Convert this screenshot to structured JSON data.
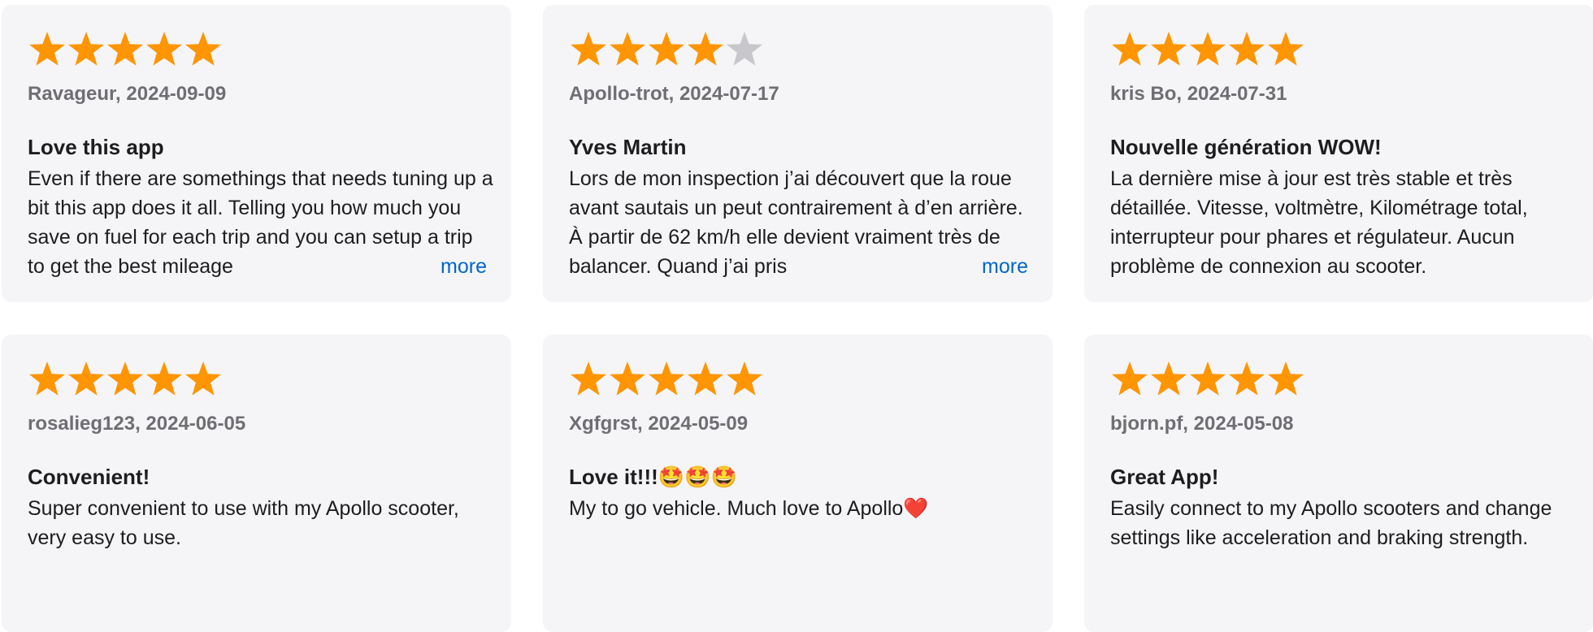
{
  "colors": {
    "star_filled": "#ff9500",
    "star_empty": "#c7c7cc",
    "link": "#0066cc"
  },
  "reviews": [
    {
      "rating": 5,
      "author_date": "Ravageur, 2024-09-09",
      "title": "Love this app",
      "body": "Even if there are somethings that needs tuning up a bit this app does it all. Telling you how much you save on fuel for each trip and you can setup a trip to get the best mileage",
      "more_label": "more"
    },
    {
      "rating": 4,
      "author_date": "Apollo-trot, 2024-07-17",
      "title": "Yves Martin",
      "body": "Lors de mon inspection j’ai découvert que la roue avant sautais un peut contrairement à d’en arrière. À partir de 62 km/h elle devient vraiment très de balancer. Quand j’ai pris",
      "more_label": "more"
    },
    {
      "rating": 5,
      "author_date": "kris Bo, 2024-07-31",
      "title": "Nouvelle génération WOW!",
      "body": "La dernière mise à jour est très stable et très détaillée. Vitesse, voltmètre, Kilométrage total, interrupteur pour phares et régulateur. Aucun problème de connexion au scooter.",
      "more_label": ""
    },
    {
      "rating": 5,
      "author_date": "rosalieg123, 2024-06-05",
      "title": "Convenient!",
      "body": "Super convenient to use with my Apollo scooter, very easy to use.",
      "more_label": ""
    },
    {
      "rating": 5,
      "author_date": "Xgfgrst, 2024-05-09",
      "title": "Love it!!!🤩🤩🤩",
      "body": "My to go vehicle. Much love to Apollo❤️",
      "more_label": ""
    },
    {
      "rating": 5,
      "author_date": "bjorn.pf, 2024-05-08",
      "title": "Great App!",
      "body": "Easily connect to my Apollo scooters and change settings like acceleration and braking strength.",
      "more_label": ""
    }
  ]
}
